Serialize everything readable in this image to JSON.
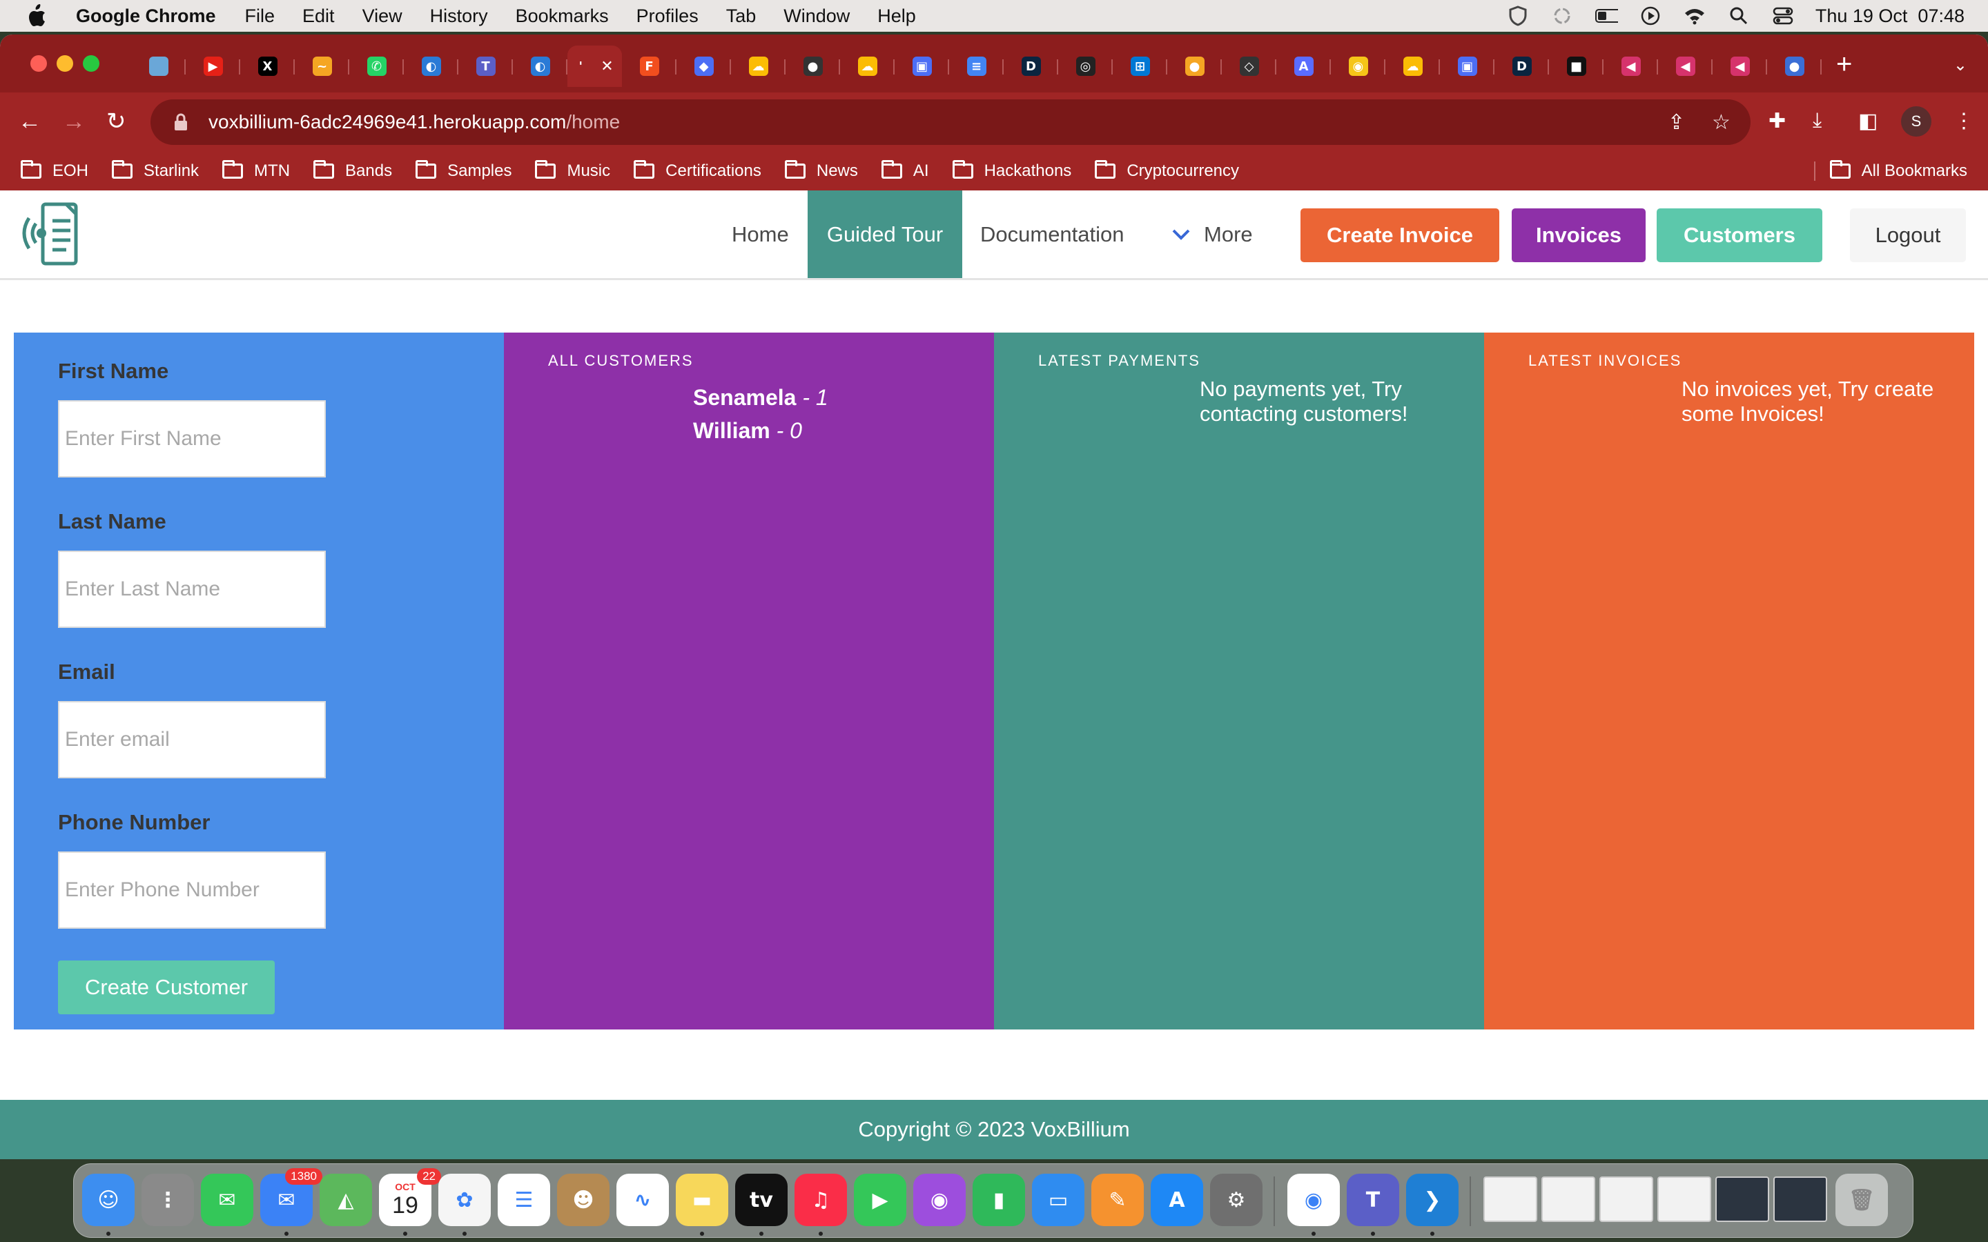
{
  "menubar": {
    "app_name": "Google Chrome",
    "items": [
      "File",
      "Edit",
      "View",
      "History",
      "Bookmarks",
      "Profiles",
      "Tab",
      "Window",
      "Help"
    ],
    "clock": "Thu 19 Oct  07:48"
  },
  "browser": {
    "url_host": "voxbillium-6adc24969e41.herokuapp.com",
    "url_path": "/home",
    "profile_initial": "S",
    "bookmarks": [
      "EOH",
      "Starlink",
      "MTN",
      "Bands",
      "Samples",
      "Music",
      "Certifications",
      "News",
      "AI",
      "Hackathons",
      "Cryptocurrency"
    ],
    "all_bookmarks": "All Bookmarks",
    "tab_icons": [
      {
        "icon": "doc-icon",
        "color": "#6aa7d8",
        "glyph": ""
      },
      {
        "icon": "youtube-icon",
        "color": "#e62117",
        "glyph": "▶"
      },
      {
        "icon": "x-icon",
        "color": "#000000",
        "glyph": "X"
      },
      {
        "icon": "rainbow-icon",
        "color": "#f5a623",
        "glyph": "~"
      },
      {
        "icon": "whatsapp-icon",
        "color": "#25d366",
        "glyph": "✆"
      },
      {
        "icon": "azure-devops-icon",
        "color": "#2a7ad6",
        "glyph": "◐"
      },
      {
        "icon": "teams-icon",
        "color": "#5b5fc7",
        "glyph": "T"
      },
      {
        "icon": "azure-devops-icon",
        "color": "#2a7ad6",
        "glyph": "◐"
      },
      {
        "icon": "active-tab-icon",
        "color": "#a02525",
        "glyph": "'"
      },
      {
        "icon": "figma-icon",
        "color": "#f24e1e",
        "glyph": "F"
      },
      {
        "icon": "vercel-icon",
        "color": "#4c6ef5",
        "glyph": "◆"
      },
      {
        "icon": "cloud-icon",
        "color": "#fbbc05",
        "glyph": "☁"
      },
      {
        "icon": "github-icon",
        "color": "#333333",
        "glyph": "●"
      },
      {
        "icon": "cloud-icon",
        "color": "#fbbc05",
        "glyph": "☁"
      },
      {
        "icon": "chip-icon",
        "color": "#4c6ef5",
        "glyph": "▣"
      },
      {
        "icon": "docs-icon",
        "color": "#4285f4",
        "glyph": "≡"
      },
      {
        "icon": "d-icon",
        "color": "#0a2540",
        "glyph": "D"
      },
      {
        "icon": "circle-icon",
        "color": "#222222",
        "glyph": "◎"
      },
      {
        "icon": "windows-icon",
        "color": "#0078d4",
        "glyph": "⊞"
      },
      {
        "icon": "orange-icon",
        "color": "#f5a623",
        "glyph": "●"
      },
      {
        "icon": "chip-icon",
        "color": "#333333",
        "glyph": "◇"
      },
      {
        "icon": "api-icon",
        "color": "#5a6cff",
        "glyph": "A"
      },
      {
        "icon": "eye-icon",
        "color": "#f5c518",
        "glyph": "◉"
      },
      {
        "icon": "cloud-icon",
        "color": "#fbbc05",
        "glyph": "☁"
      },
      {
        "icon": "chip-icon",
        "color": "#4c6ef5",
        "glyph": "▣"
      },
      {
        "icon": "d-icon",
        "color": "#0a2540",
        "glyph": "D"
      },
      {
        "icon": "square-icon",
        "color": "#111111",
        "glyph": "■"
      },
      {
        "icon": "rewind-icon",
        "color": "#d6336c",
        "glyph": "◀"
      },
      {
        "icon": "rewind-icon",
        "color": "#d6336c",
        "glyph": "◀"
      },
      {
        "icon": "rewind-icon",
        "color": "#d6336c",
        "glyph": "◀"
      },
      {
        "icon": "globe-icon",
        "color": "#3b6fd6",
        "glyph": "●"
      }
    ]
  },
  "nav": {
    "home": "Home",
    "guided_tour": "Guided Tour",
    "documentation": "Documentation",
    "more": "More",
    "create_invoice": "Create Invoice",
    "invoices": "Invoices",
    "customers": "Customers",
    "logout": "Logout"
  },
  "form": {
    "first_name_label": "First Name",
    "first_name_placeholder": "Enter First Name",
    "last_name_label": "Last Name",
    "last_name_placeholder": "Enter Last Name",
    "email_label": "Email",
    "email_placeholder": "Enter email",
    "phone_label": "Phone Number",
    "phone_placeholder": "Enter Phone Number",
    "submit": "Create Customer"
  },
  "customers_panel": {
    "heading": "ALL CUSTOMERS",
    "items": [
      {
        "name": "Senamela",
        "count": "1"
      },
      {
        "name": "William",
        "count": "0"
      }
    ]
  },
  "payments_panel": {
    "heading": "LATEST PAYMENTS",
    "empty": "No payments yet, Try contacting customers!"
  },
  "invoices_panel": {
    "heading": "LATEST INVOICES",
    "empty": "No invoices yet, Try create some Invoices!"
  },
  "footer": {
    "text": "Copyright © 2023 VoxBillium"
  },
  "dock": {
    "calendar_month": "OCT",
    "calendar_day": "19",
    "calendar_badge": "22",
    "mail_badge": "1380",
    "apps": [
      {
        "name": "finder-icon",
        "color": "#3d8ef0",
        "glyph": "☺"
      },
      {
        "name": "launchpad-icon",
        "color": "#8a8a8a",
        "glyph": "⋮"
      },
      {
        "name": "messages-icon",
        "color": "#34c759",
        "glyph": "✉"
      },
      {
        "name": "mail-icon",
        "color": "#3b82f6",
        "glyph": "✉"
      },
      {
        "name": "maps-icon",
        "color": "#5cb85c",
        "glyph": "◭"
      },
      {
        "name": "calendar-icon",
        "color": "#ffffff",
        "glyph": ""
      },
      {
        "name": "photos-icon",
        "color": "#f5f5f5",
        "glyph": "✿"
      },
      {
        "name": "reminders-icon",
        "color": "#ffffff",
        "glyph": "☰"
      },
      {
        "name": "contacts-icon",
        "color": "#b58a52",
        "glyph": "☻"
      },
      {
        "name": "freeform-icon",
        "color": "#ffffff",
        "glyph": "∿"
      },
      {
        "name": "notes-icon",
        "color": "#f7d75a",
        "glyph": "▬"
      },
      {
        "name": "apple-tv-icon",
        "color": "#111111",
        "glyph": "tv"
      },
      {
        "name": "music-icon",
        "color": "#fa2d48",
        "glyph": "♫"
      },
      {
        "name": "facetime-icon",
        "color": "#34c759",
        "glyph": "▶"
      },
      {
        "name": "podcasts-icon",
        "color": "#9d4edd",
        "glyph": "◉"
      },
      {
        "name": "numbers-icon",
        "color": "#2fb95a",
        "glyph": "▮"
      },
      {
        "name": "keynote-icon",
        "color": "#2f8cf0",
        "glyph": "▭"
      },
      {
        "name": "pages-icon",
        "color": "#f5922f",
        "glyph": "✎"
      },
      {
        "name": "app-store-icon",
        "color": "#1e88f5",
        "glyph": "A"
      },
      {
        "name": "system-settings-icon",
        "color": "#6f6f6f",
        "glyph": "⚙"
      },
      {
        "name": "chrome-icon",
        "color": "#ffffff",
        "glyph": "◉"
      },
      {
        "name": "teams-icon",
        "color": "#5b5fc7",
        "glyph": "T"
      },
      {
        "name": "vscode-icon",
        "color": "#1f7fd4",
        "glyph": "❯"
      }
    ]
  }
}
